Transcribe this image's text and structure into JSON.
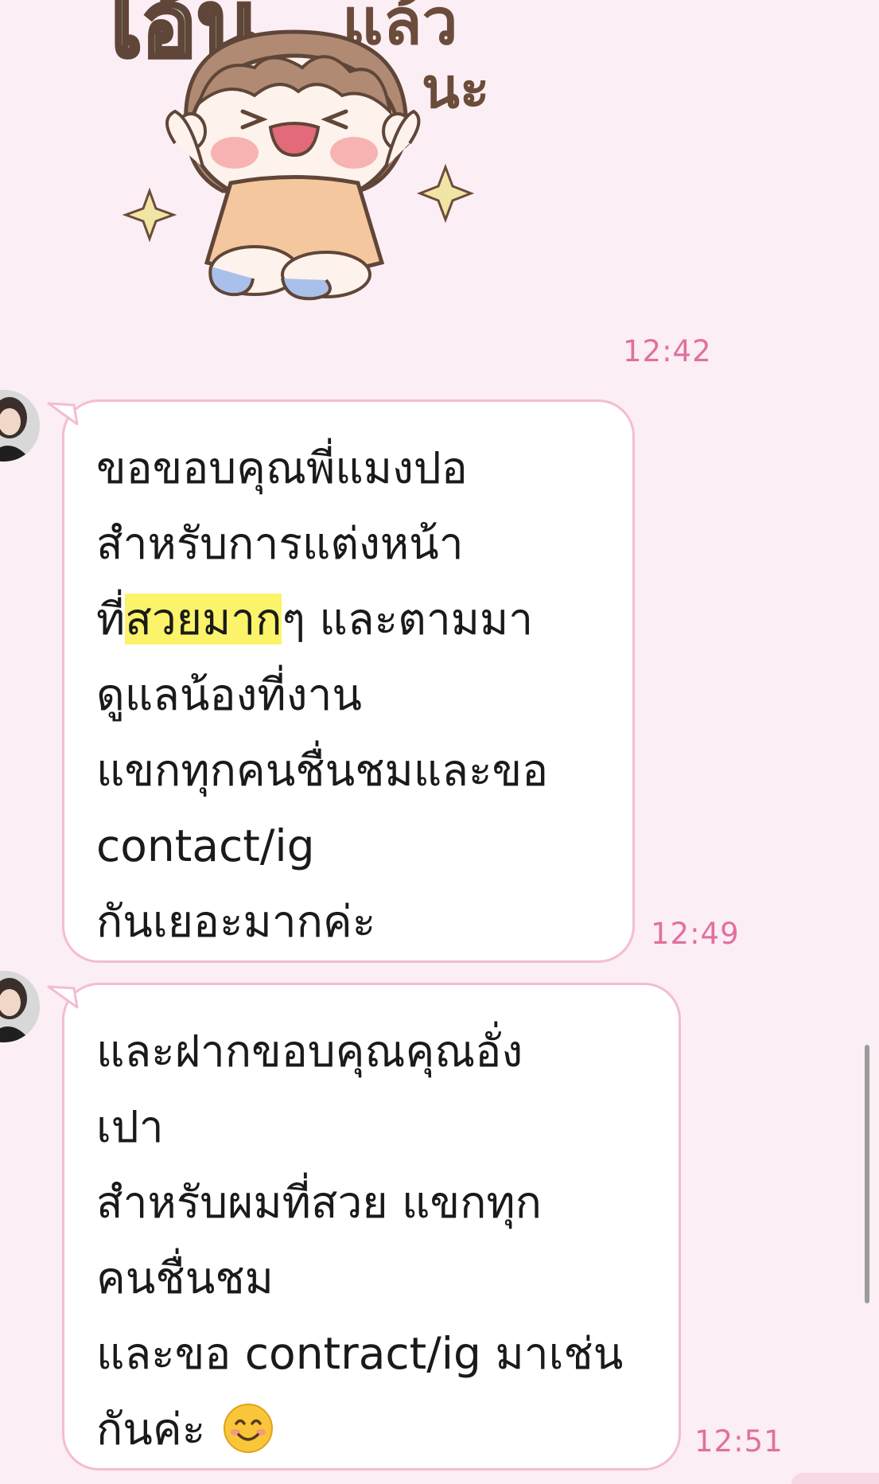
{
  "sticker": {
    "text_line1": "ไอ้นแล้ว",
    "text_line2": "นะ",
    "time": "12:42"
  },
  "messages": [
    {
      "lines": [
        [
          "ขอขอบคุณพี่แมงปอ"
        ],
        [
          "สำหรับการแต่งหน้า"
        ],
        [
          "ที่",
          "สวยมาก",
          "ๆ และตามมา"
        ],
        [
          "ดูแลน้องที่งาน"
        ],
        [
          "แขกทุกคนชื่นชมและขอ"
        ],
        [
          "contact/ig"
        ],
        [
          "กันเยอะมากค่ะ"
        ]
      ],
      "highlight": "สวยมาก",
      "time": "12:49"
    },
    {
      "lines": [
        [
          "และฝากขอบคุณคุณอั่ง"
        ],
        [
          "เปา"
        ],
        [
          "สำหรับผมที่สวย แขกทุก"
        ],
        [
          "คนชื่นชม"
        ],
        [
          "และขอ contract/ig มาเช่น"
        ],
        [
          "กันค่ะ"
        ]
      ],
      "emoji": "smiling-face-emoji",
      "time": "12:51"
    }
  ],
  "colors": {
    "background": "#fbeef4",
    "bubble_border": "#f3bcd3",
    "timestamp": "#e0709f",
    "highlight": "#fbf36a"
  }
}
